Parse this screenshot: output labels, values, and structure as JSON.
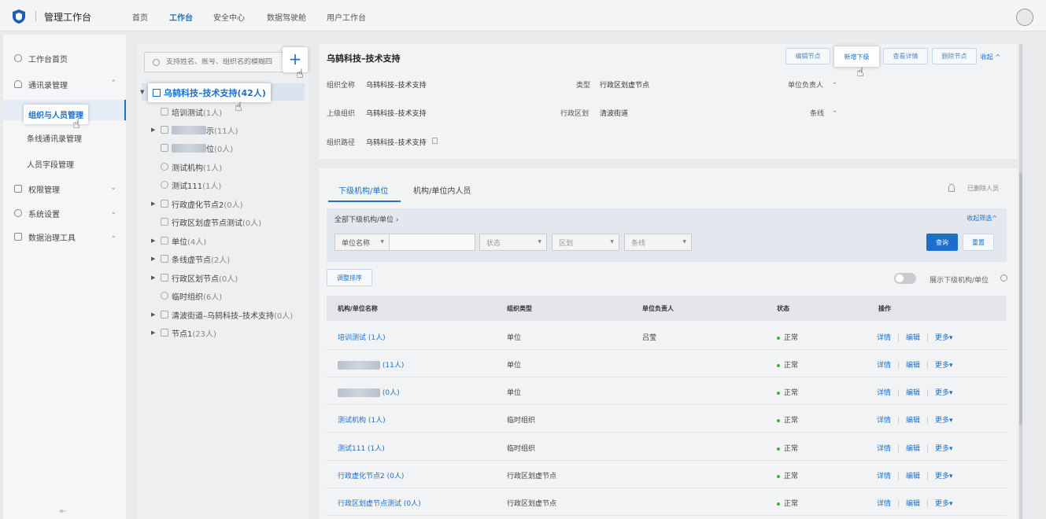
{
  "topbar": {
    "app_title": "管理工作台",
    "nav": [
      "首页",
      "工作台",
      "安全中心",
      "数据驾驶舱",
      "用户工作台"
    ],
    "active_nav": "工作台"
  },
  "sidebar": {
    "items": [
      {
        "label": "工作台首页",
        "icon": "dashboard-icon"
      },
      {
        "label": "通讯录管理",
        "icon": "contacts-icon",
        "expanded": true
      },
      {
        "label": "组织与人员管理",
        "active": true
      },
      {
        "label": "条线通讯录管理"
      },
      {
        "label": "人员字段管理"
      },
      {
        "label": "权限管理",
        "icon": "grid-icon"
      },
      {
        "label": "系统设置",
        "icon": "gear-icon"
      },
      {
        "label": "数据治理工具",
        "icon": "database-icon"
      }
    ]
  },
  "tree": {
    "search_placeholder": "支持姓名、账号、组织名的模糊四",
    "add_label": "+",
    "root": {
      "name": "乌鸫科技–技术支持",
      "count": "(42人)"
    },
    "nodes": [
      {
        "name": "培训测试",
        "count": "(1人)",
        "expandable": false
      },
      {
        "name": "示",
        "count": "(11人)",
        "expandable": true,
        "masked": true
      },
      {
        "name": "位",
        "count": "(0人)",
        "expandable": false,
        "masked": true
      },
      {
        "name": "测试机构",
        "count": "(1人)",
        "expandable": false
      },
      {
        "name": "测试111",
        "count": "(1人)",
        "expandable": false
      },
      {
        "name": "行政虚化节点2",
        "count": "(0人)",
        "expandable": true
      },
      {
        "name": "行政区划虚节点测试",
        "count": "(0人)",
        "expandable": false
      },
      {
        "name": "单位",
        "count": "(4人)",
        "expandable": true
      },
      {
        "name": "条线虚节点",
        "count": "(2人)",
        "expandable": true
      },
      {
        "name": "行政区划节点",
        "count": "(0人)",
        "expandable": true
      },
      {
        "name": "临时组织",
        "count": "(6人)",
        "expandable": false
      },
      {
        "name": "清波街道–乌鸫科技–技术支持",
        "count": "(0人)",
        "expandable": true
      },
      {
        "name": "节点1",
        "count": "(23人)",
        "expandable": true
      }
    ]
  },
  "detail": {
    "title": "乌鸫科技–技术支持",
    "buttons": [
      "编辑节点",
      "新增下级",
      "查看详情",
      "删除节点"
    ],
    "collapse": "收起 ^",
    "fields": {
      "full_name_label": "组织全称",
      "full_name": "乌鸫科技–技术支持",
      "type_label": "类型",
      "type": "行政区划虚节点",
      "leader_label": "单位负责人",
      "leader": "-",
      "parent_label": "上级组织",
      "parent": "乌鸫科技–技术支持",
      "district_label": "行政区划",
      "district": "清波街道",
      "line_label": "条线",
      "line": "-",
      "path_label": "组织路径",
      "path": "乌鸫科技–技术支持"
    }
  },
  "lower": {
    "tabs": [
      "下级机构/单位",
      "机构/单位内人员"
    ],
    "deleted_link": "已删除人员",
    "filter": {
      "crumb": "全部下级机构/单位 ›",
      "collapse": "收起筛选^",
      "field_select": "单位名称",
      "status_placeholder": "状态",
      "district_placeholder": "区划",
      "line_placeholder": "条线",
      "query": "查询",
      "reset": "重置"
    },
    "sort_button": "调整排序",
    "toggle_label": "展示下级机构/单位",
    "columns": [
      "机构/单位名称",
      "组织类型",
      "单位负责人",
      "状态",
      "操作"
    ],
    "rows": [
      {
        "name": "培训测试 (1人)",
        "type": "单位",
        "leader": "吕莹",
        "status": "正常"
      },
      {
        "name": "(11人)",
        "type": "单位",
        "leader": "",
        "status": "正常",
        "masked": true
      },
      {
        "name": "(0人)",
        "type": "单位",
        "leader": "",
        "status": "正常",
        "masked": true
      },
      {
        "name": "测试机构 (1人)",
        "type": "临时组织",
        "leader": "",
        "status": "正常"
      },
      {
        "name": "测试111 (1人)",
        "type": "临时组织",
        "leader": "",
        "status": "正常"
      },
      {
        "name": "行政虚化节点2 (0人)",
        "type": "行政区划虚节点",
        "leader": "",
        "status": "正常"
      },
      {
        "name": "行政区划虚节点测试 (0人)",
        "type": "行政区划虚节点",
        "leader": "",
        "status": "正常"
      }
    ],
    "ops": [
      "详情",
      "编辑",
      "更多▾"
    ]
  },
  "colors": {
    "accent": "#1c6fc9",
    "status_ok": "#3cb043"
  }
}
